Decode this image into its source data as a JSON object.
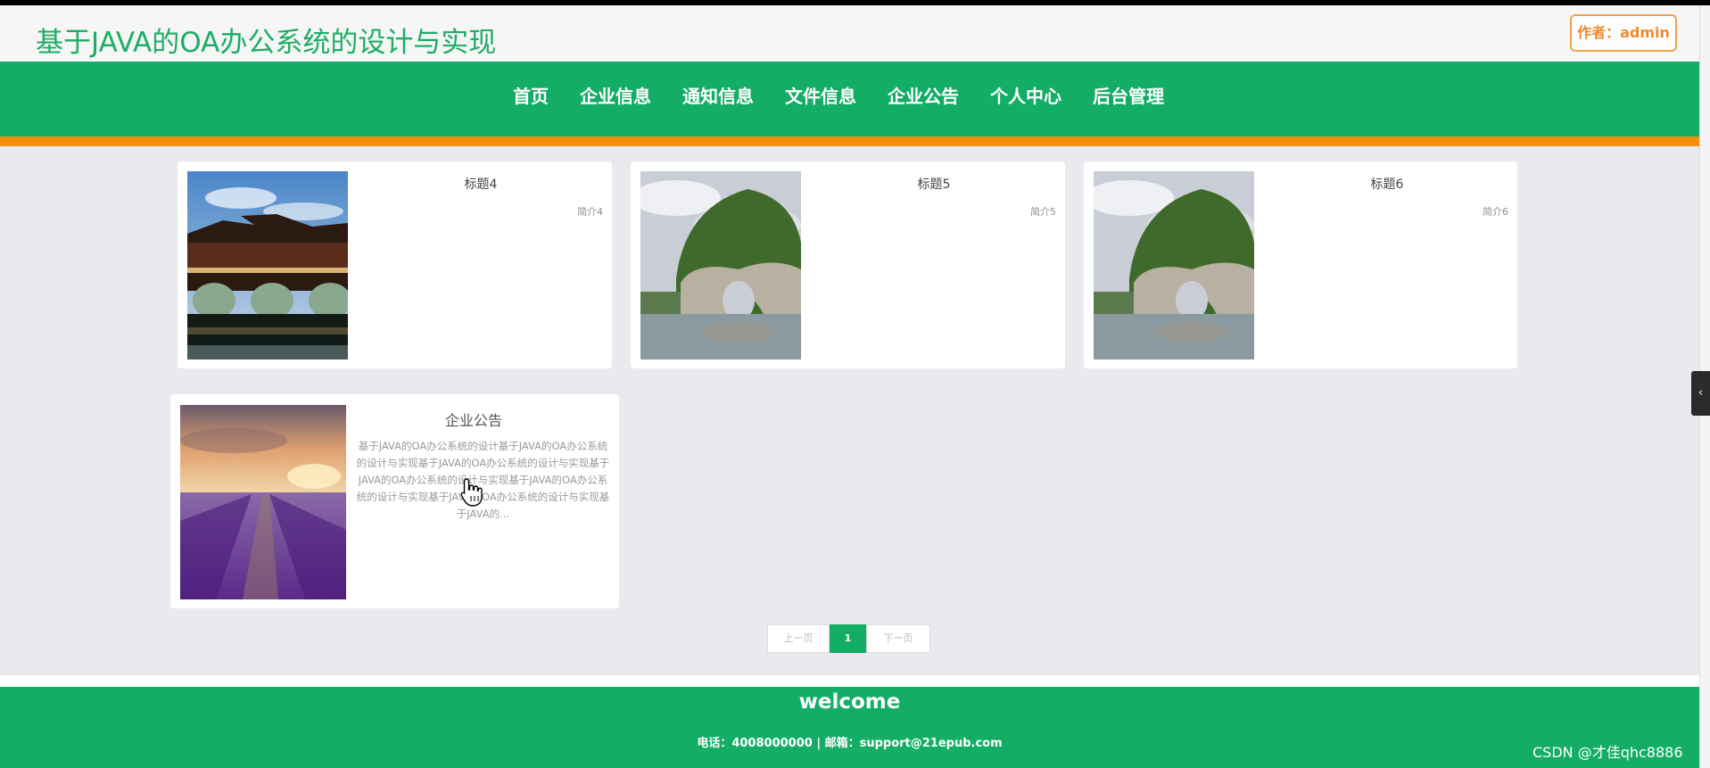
{
  "header": {
    "site_title": "基于JAVA的OA办公系统的设计与实现",
    "author_label": "作者：admin"
  },
  "nav": {
    "items": [
      "首页",
      "企业信息",
      "通知信息",
      "文件信息",
      "企业公告",
      "个人中心",
      "后台管理"
    ]
  },
  "cards": [
    {
      "title": "标题4",
      "intro": "简介4",
      "image": "covered-bridge-photo"
    },
    {
      "title": "标题5",
      "intro": "简介5",
      "image": "elephant-trunk-hill-photo"
    },
    {
      "title": "标题6",
      "intro": "简介6",
      "image": "elephant-trunk-hill-photo"
    }
  ],
  "notice": {
    "title": "企业公告",
    "text": "基于JAVA的OA办公系统的设计基于JAVA的OA办公系统的设计与实现基于JAVA的OA办公系统的设计与实现基于JAVA的OA办公系统的设计与实现基于JAVA的OA办公系统的设计与实现基于JAVA的OA办公系统的设计与实现基于JAVA的...",
    "image": "lavender-field-photo"
  },
  "pagination": {
    "prev_label": "上一页",
    "current_page": "1",
    "next_label": "下一页"
  },
  "footer": {
    "welcome": "welcome",
    "contact": "电话：4008000000 | 邮箱：support@21epub.com"
  },
  "watermark": "CSDN @才佳qhc8886",
  "colors": {
    "brand_green": "#13ad66",
    "accent_orange": "#f2900e",
    "title_green": "#1ead65"
  }
}
